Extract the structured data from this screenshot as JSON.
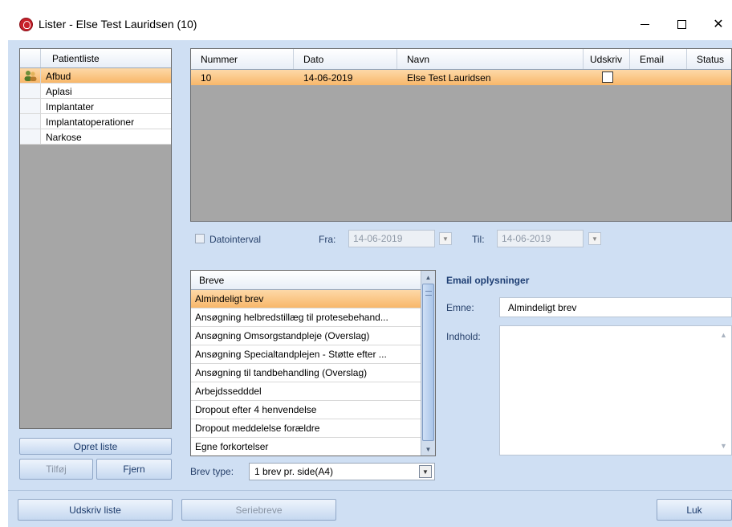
{
  "window": {
    "title": "Lister - Else Test Lauridsen (10)",
    "minimize_glyph": "",
    "close_glyph": "✕"
  },
  "patientlist": {
    "header": "Patientliste",
    "items": [
      "Afbud",
      "Aplasi",
      "Implantater",
      "Implantatoperationer",
      "Narkose"
    ],
    "selected_index": 0,
    "create_button": "Opret liste",
    "add_button": "Tilføj",
    "remove_button": "Fjern"
  },
  "grid": {
    "columns": [
      "Nummer",
      "Dato",
      "Navn",
      "Udskriv",
      "Email",
      "Status"
    ],
    "rows": [
      {
        "nummer": "10",
        "dato": "14-06-2019",
        "navn": "Else Test Lauridsen",
        "udskriv": false
      }
    ]
  },
  "date_filter": {
    "checkbox_label": "Datointerval",
    "from_label": "Fra:",
    "from_value": "14-06-2019",
    "to_label": "Til:",
    "to_value": "14-06-2019"
  },
  "letters": {
    "header": "Breve",
    "items": [
      "Almindeligt brev",
      "Ansøgning helbredstillæg til protesebehand...",
      "Ansøgning Omsorgstandpleje (Overslag)",
      "Ansøgning Specialtandplejen - Støtte efter ...",
      "Ansøgning til tandbehandling (Overslag)",
      "Arbejdssedddel",
      "Dropout efter 4 henvendelse",
      "Dropout meddelelse forældre",
      "Egne forkortelser"
    ],
    "selected_index": 0,
    "type_label": "Brev type:",
    "type_value": "1 brev pr. side(A4)"
  },
  "email": {
    "title": "Email oplysninger",
    "subject_label": "Emne:",
    "subject_value": "Almindeligt brev",
    "body_label": "Indhold:",
    "body_value": ""
  },
  "footer": {
    "print_list_button": "Udskriv liste",
    "serial_letters_button": "Seriebreve",
    "close_button": "Luk"
  },
  "colors": {
    "selection": "#f8b76a",
    "client_bg": "#cfdff3",
    "button_text": "#1b3a6b"
  }
}
